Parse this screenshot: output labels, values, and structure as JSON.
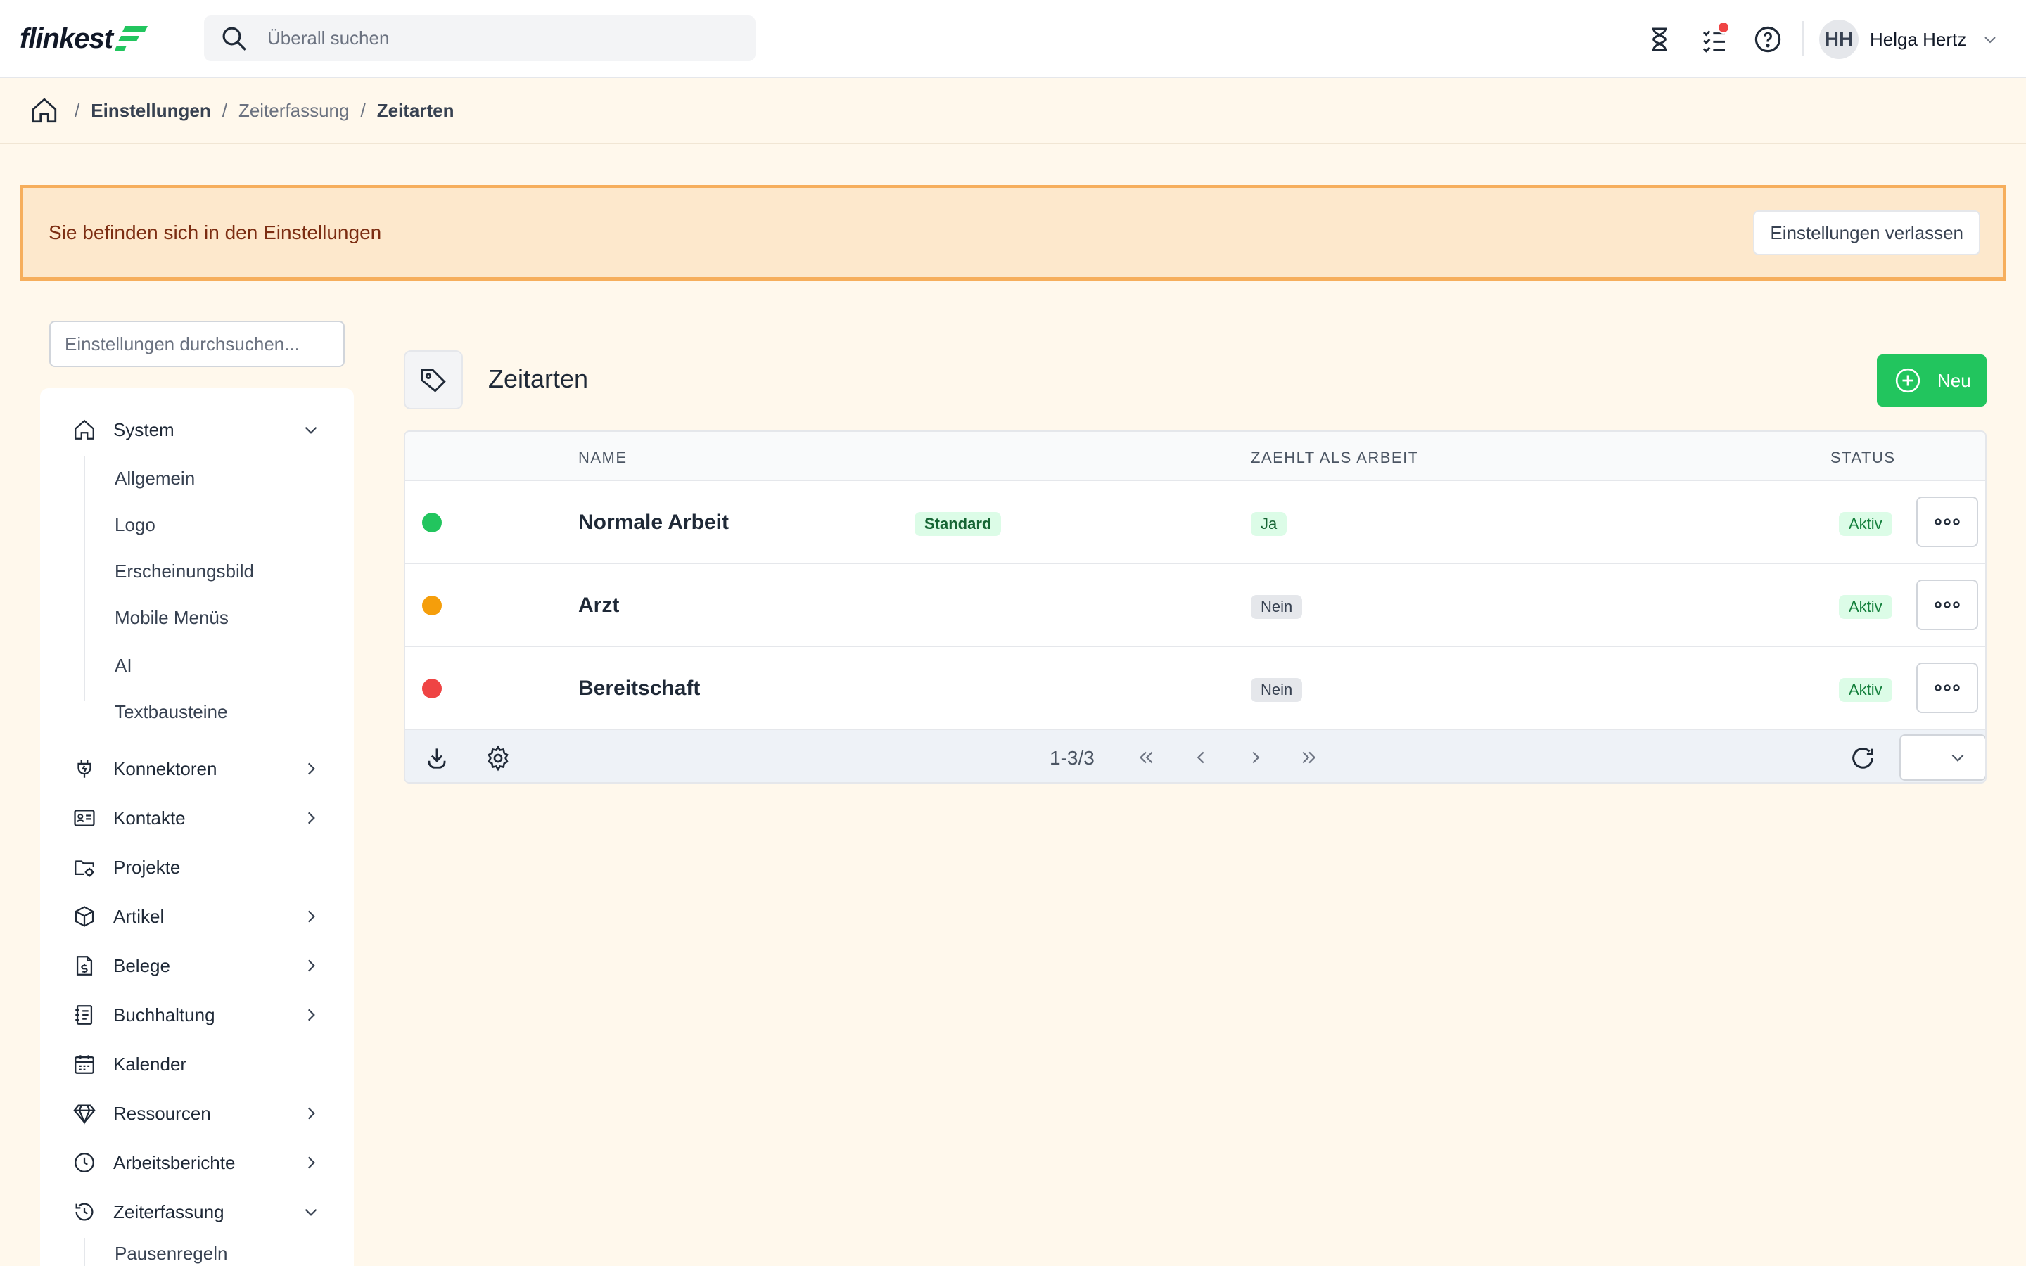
{
  "header": {
    "logo_text": "flinkest",
    "search_placeholder": "Überall suchen",
    "user_initials": "HH",
    "user_name": "Helga Hertz"
  },
  "breadcrumb": {
    "items": [
      "Einstellungen",
      "Zeiterfassung",
      "Zeitarten"
    ]
  },
  "banner": {
    "message": "Sie befinden sich in den Einstellungen",
    "exit_label": "Einstellungen verlassen"
  },
  "sidebar": {
    "search_placeholder": "Einstellungen durchsuchen...",
    "system": {
      "label": "System",
      "subitems": [
        "Allgemein",
        "Logo",
        "Erscheinungsbild",
        "Mobile Menüs",
        "AI",
        "Textbausteine"
      ]
    },
    "items": [
      {
        "label": "Konnektoren",
        "icon": "plug-icon"
      },
      {
        "label": "Kontakte",
        "icon": "contact-card-icon"
      },
      {
        "label": "Projekte",
        "icon": "folder-gear-icon"
      },
      {
        "label": "Artikel",
        "icon": "cube-icon"
      },
      {
        "label": "Belege",
        "icon": "receipt-icon"
      },
      {
        "label": "Buchhaltung",
        "icon": "ledger-icon"
      },
      {
        "label": "Kalender",
        "icon": "calendar-icon"
      },
      {
        "label": "Ressourcen",
        "icon": "diamond-icon"
      },
      {
        "label": "Arbeitsberichte",
        "icon": "clock-icon"
      }
    ],
    "zeiterfassung": {
      "label": "Zeiterfassung",
      "subitems": [
        "Pausenregeln"
      ]
    }
  },
  "page": {
    "title": "Zeitarten",
    "new_label": "Neu"
  },
  "table": {
    "columns": {
      "name": "NAME",
      "counts_as_work": "ZAEHLT ALS ARBEIT",
      "status": "STATUS"
    },
    "rows": [
      {
        "color": "#22c55e",
        "name": "Normale Arbeit",
        "tag": "Standard",
        "counts": "Ja",
        "status": "Aktiv"
      },
      {
        "color": "#f59e0b",
        "name": "Arzt",
        "tag": "",
        "counts": "Nein",
        "status": "Aktiv"
      },
      {
        "color": "#ef4444",
        "name": "Bereitschaft",
        "tag": "",
        "counts": "Nein",
        "status": "Aktiv"
      }
    ],
    "pagination": "1-3/3"
  }
}
